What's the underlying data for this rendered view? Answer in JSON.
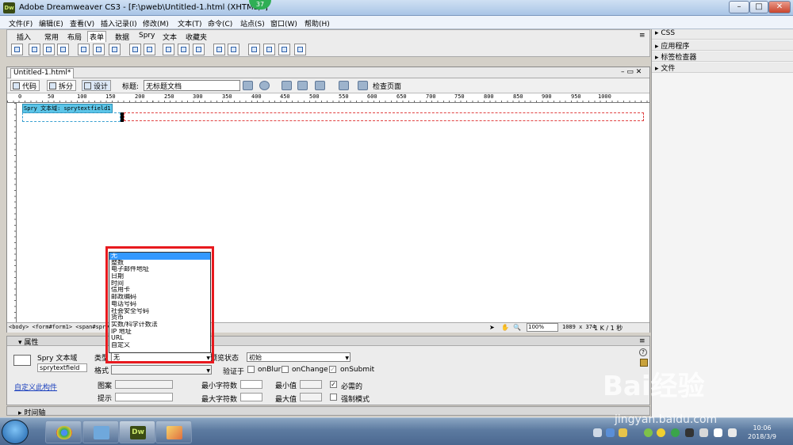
{
  "window": {
    "app_icon": "Dw",
    "title": "Adobe Dreamweaver CS3 - [F:\\pweb\\Untitled-1.html (XHTML)*]",
    "badge": "37",
    "min": "–",
    "max": "□",
    "close": "✕"
  },
  "menu": [
    "文件(F)",
    "编辑(E)",
    "查看(V)",
    "插入记录(I)",
    "修改(M)",
    "文本(T)",
    "命令(C)",
    "站点(S)",
    "窗口(W)",
    "帮助(H)"
  ],
  "insert_bar": {
    "tabs": [
      "插入",
      "常用",
      "布局",
      "表单",
      "数据",
      "Spry",
      "文本",
      "收藏夹"
    ],
    "selected": "表单"
  },
  "right_panels": [
    "CSS",
    "应用程序",
    "标签检查器",
    "文件"
  ],
  "document": {
    "tab": "Untitled-1.html*",
    "view_buttons": [
      "代码",
      "拆分",
      "设计"
    ],
    "title_label": "标题:",
    "title_value": "无标题文档",
    "validate_label": "检查页面",
    "ruler_marks": [
      "0",
      "50",
      "100",
      "150",
      "200",
      "250",
      "300",
      "350",
      "400",
      "450",
      "500",
      "550",
      "600",
      "650",
      "700",
      "750",
      "800",
      "850",
      "900",
      "950",
      "1000"
    ],
    "spry_tag": "Spry 文本域: sprytextfield1",
    "tag_selector": "<body> <form#form1> <span#spry",
    "zoom": "100%",
    "dimensions": "1089 x 374",
    "size_info": "1 K / 1 秒"
  },
  "properties": {
    "header": "属性",
    "widget_label": "Spry 文本域",
    "widget_name": "sprytextfield",
    "customize_link": "自定义此构件",
    "type_label": "类型",
    "type_value": "无",
    "format_label": "格式",
    "pattern_label": "图案",
    "hint_label": "提示",
    "preview_label": "预览状态",
    "preview_value": "初始",
    "validate_on_label": "验证于",
    "onblur": "onBlur",
    "onchange": "onChange",
    "onsubmit": "onSubmit",
    "min_chars": "最小字符数",
    "max_chars": "最大字符数",
    "min_value": "最小值",
    "max_value": "最大值",
    "required": "必需的",
    "enforce": "强制模式"
  },
  "type_options": [
    "无",
    "整数",
    "电子邮件地址",
    "日期",
    "时间",
    "信用卡",
    "邮政编码",
    "电话号码",
    "社会安全号码",
    "货币",
    "实数/科学计数法",
    "IP 地址",
    "URL",
    "自定义"
  ],
  "timeline": "时间轴",
  "taskbar": {
    "clock_time": "10:06",
    "clock_date": "2018/3/9",
    "apps": [
      "chrome",
      "notepad",
      "Dw",
      "paint"
    ]
  },
  "watermark": {
    "main": "Bai经验",
    "sub": "jingyan.baidu.com"
  }
}
